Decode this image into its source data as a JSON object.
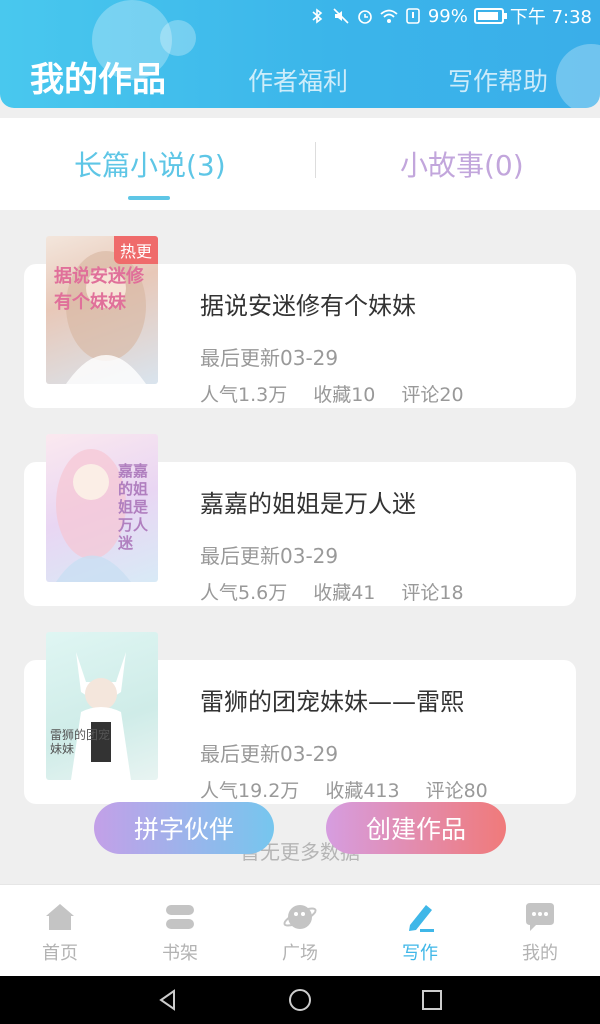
{
  "status": {
    "percent": "99%",
    "time": "下午 7:38"
  },
  "header": {
    "tabs": [
      {
        "label": "我的作品",
        "active": true
      },
      {
        "label": "作者福利"
      },
      {
        "label": "写作帮助"
      }
    ]
  },
  "subtabs": [
    {
      "label": "长篇小说(3)",
      "active": true
    },
    {
      "label": "小故事(0)"
    }
  ],
  "books": [
    {
      "title": "据说安迷修有个妹妹",
      "updated": "最后更新03-29",
      "popularity": "人气1.3万",
      "favorites": "收藏10",
      "comments": "评论20",
      "badge": "热更",
      "cover_text": "据说安迷修有个妹妹"
    },
    {
      "title": "嘉嘉的姐姐是万人迷",
      "updated": "最后更新03-29",
      "popularity": "人气5.6万",
      "favorites": "收藏41",
      "comments": "评论18",
      "cover_text": "嘉嘉的姐姐是万人迷"
    },
    {
      "title": "雷狮的团宠妹妹——雷熙",
      "updated": "最后更新03-29",
      "popularity": "人气19.2万",
      "favorites": "收藏413",
      "comments": "评论80",
      "cover_text": "雷狮的团宠妹妹"
    }
  ],
  "no_more": "暂无更多数据",
  "buttons": {
    "partner": "拼字伙伴",
    "create": "创建作品"
  },
  "bottom_nav": [
    {
      "label": "首页",
      "icon": "home-icon"
    },
    {
      "label": "书架",
      "icon": "bookshelf-icon"
    },
    {
      "label": "广场",
      "icon": "planet-icon"
    },
    {
      "label": "写作",
      "icon": "pen-icon",
      "active": true
    },
    {
      "label": "我的",
      "icon": "chat-icon"
    }
  ],
  "colors": {
    "accent": "#3fb7e8",
    "header": "#3bb5ea",
    "badge": "#ef6b6b"
  }
}
